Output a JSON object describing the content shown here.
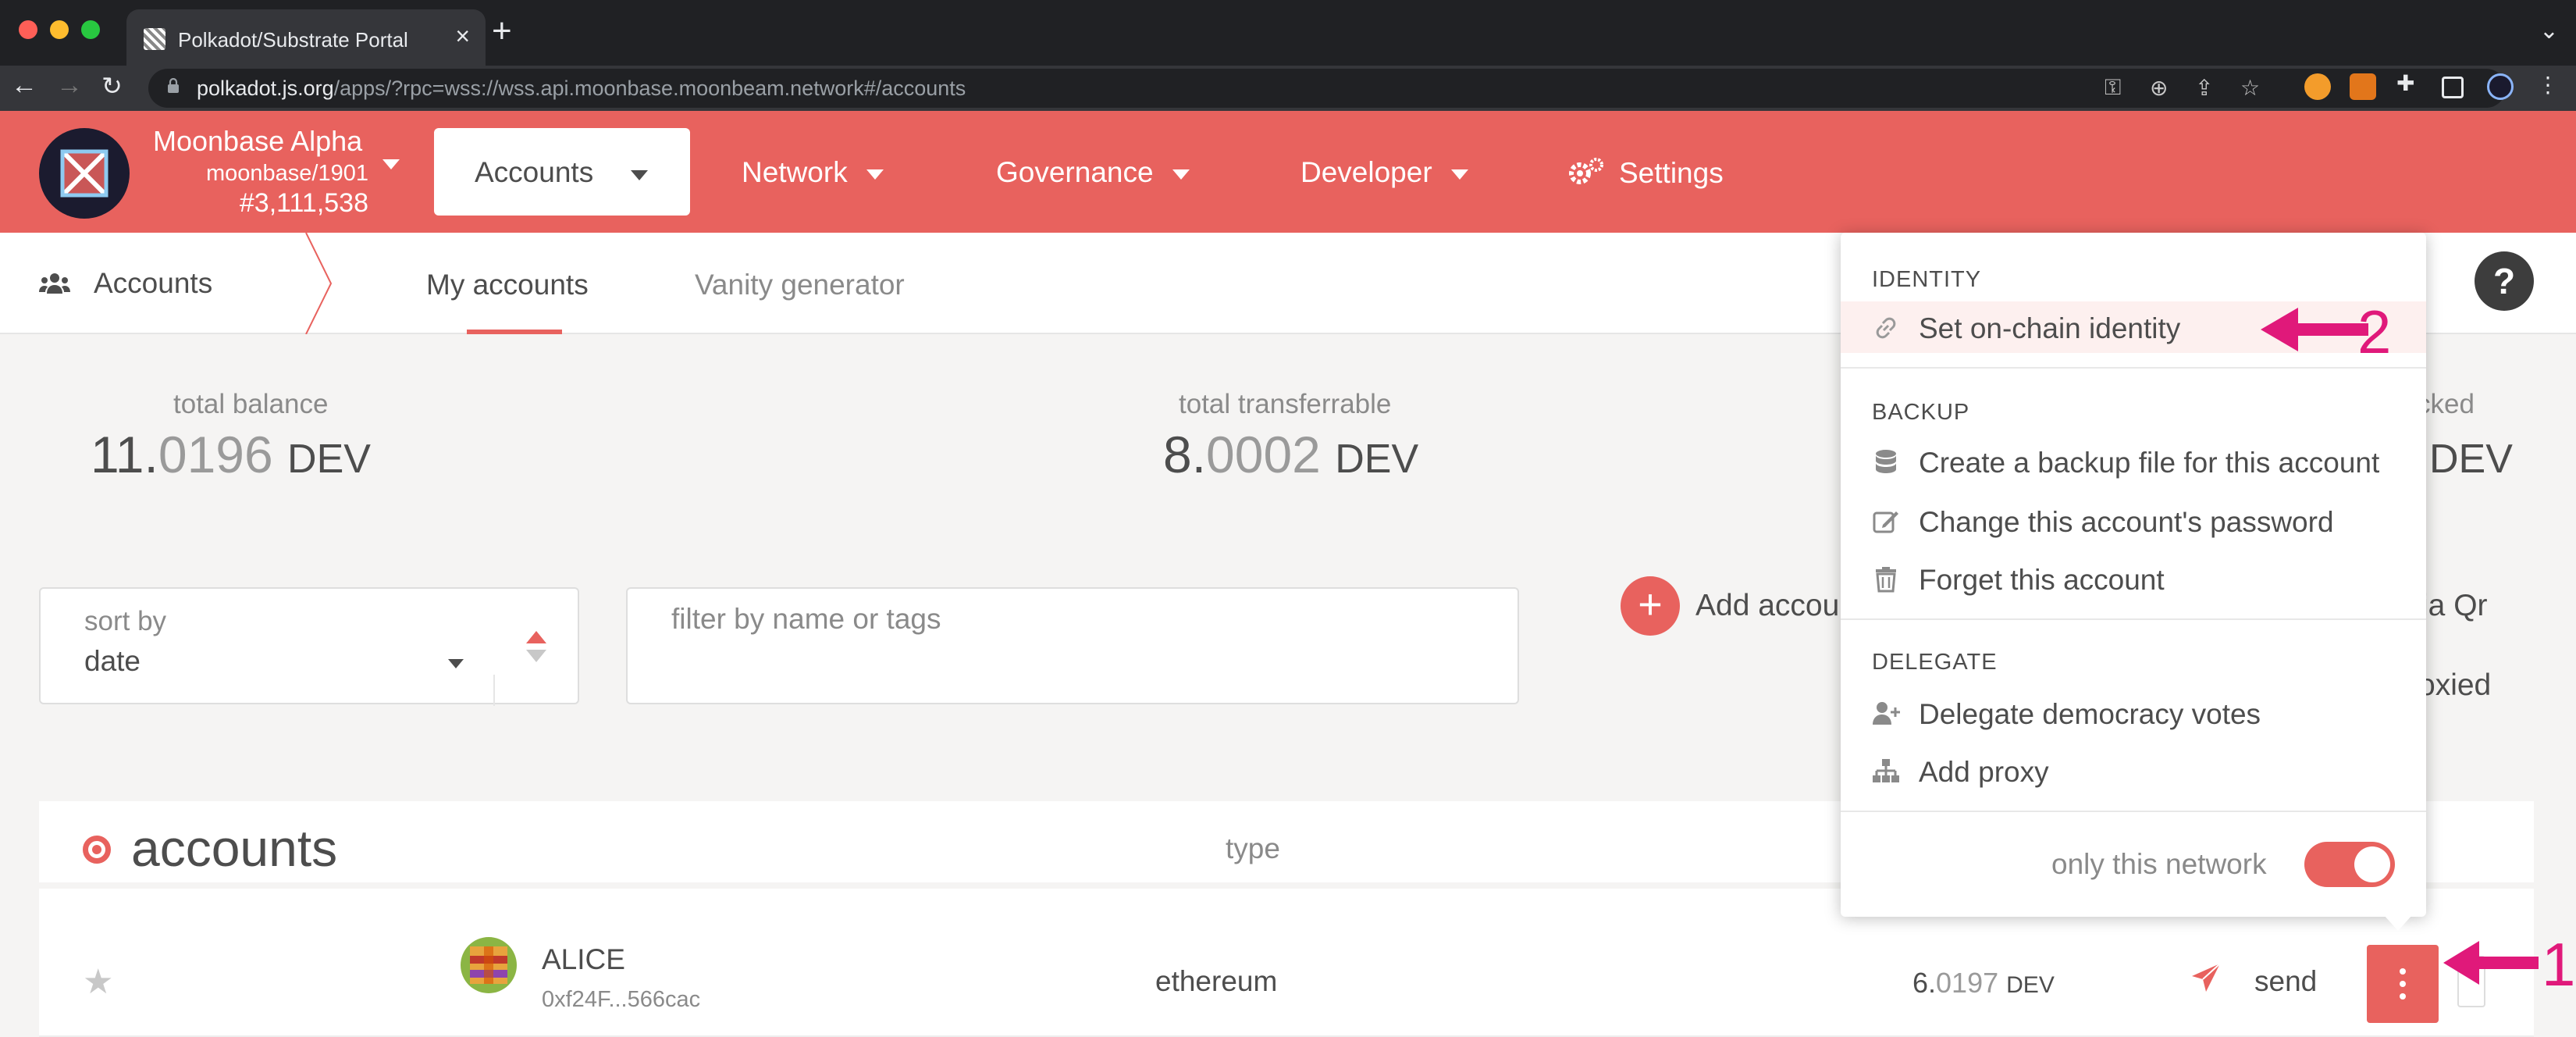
{
  "browser": {
    "tab_title": "Polkadot/Substrate Portal",
    "url_host": "polkadot.js.org",
    "url_rest": "/apps/?rpc=wss://wss.api.moonbase.moonbeam.network#/accounts"
  },
  "chain": {
    "name": "Moonbase Alpha",
    "spec": "moonbase/1901",
    "block": "#3,111,538"
  },
  "menu": {
    "accounts": "Accounts",
    "network": "Network",
    "governance": "Governance",
    "developer": "Developer",
    "settings": "Settings"
  },
  "subnav": {
    "section": "Accounts",
    "tabs": [
      "My accounts",
      "Vanity generator"
    ]
  },
  "summary": {
    "total_balance_label": "total balance",
    "total_balance_int": "11.",
    "total_balance_frac": "0196",
    "total_balance_unit": "DEV",
    "transferrable_label": "total transferrable",
    "transferrable_int": "8.",
    "transferrable_frac": "0002",
    "transferrable_unit": "DEV",
    "locked_label_clip": "cked",
    "locked_unit_clip": "DEV"
  },
  "filters": {
    "sort_label": "sort by",
    "sort_value": "date",
    "filter_placeholder": "filter by name or tags",
    "add_account": "Add accou",
    "via_qr_clip": "ia Qr",
    "proxied_clip": "oxied"
  },
  "table": {
    "title": "accounts",
    "type_header": "type",
    "row": {
      "name": "ALICE",
      "address": "0xf24F...566cac",
      "type": "ethereum",
      "balance_int": "6.",
      "balance_frac": "0197",
      "balance_unit": "DEV",
      "send": "send"
    }
  },
  "popup": {
    "identity_header": "IDENTITY",
    "set_identity": "Set on-chain identity",
    "backup_header": "BACKUP",
    "create_backup": "Create a backup file for this account",
    "change_password": "Change this account's password",
    "forget": "Forget this account",
    "delegate_header": "DELEGATE",
    "delegate_votes": "Delegate democracy votes",
    "add_proxy": "Add proxy",
    "only_network": "only this network",
    "only_network_on": true
  },
  "annotations": {
    "step1": "1",
    "step2": "2"
  },
  "colors": {
    "accent": "#e8625e",
    "annotation": "#e0197a"
  }
}
